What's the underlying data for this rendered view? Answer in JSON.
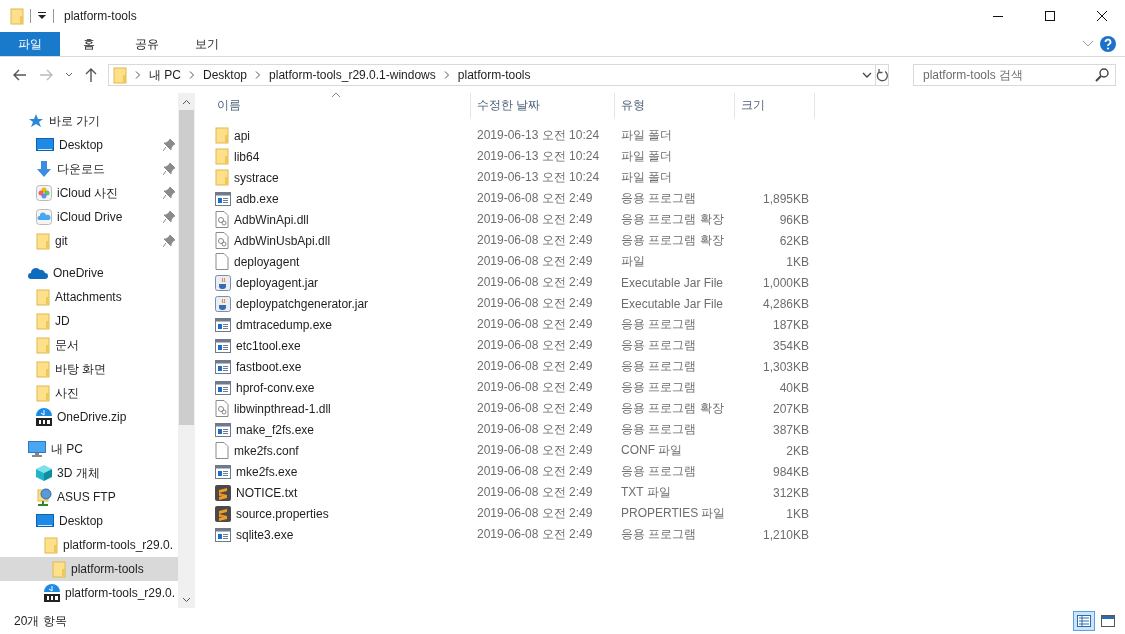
{
  "window": {
    "title": "platform-tools"
  },
  "ribbon_tabs": [
    {
      "label": "파일",
      "selected": true
    },
    {
      "label": "홈",
      "selected": false
    },
    {
      "label": "공유",
      "selected": false
    },
    {
      "label": "보기",
      "selected": false
    }
  ],
  "address": {
    "crumbs": [
      "내 PC",
      "Desktop",
      "platform-tools_r29.0.1-windows",
      "platform-tools"
    ]
  },
  "search": {
    "placeholder": "platform-tools 검색"
  },
  "sidebar": {
    "groups": [
      {
        "label": "바로 가기",
        "kind": "star",
        "selected": false,
        "children": [
          {
            "label": "Desktop",
            "kind": "desktop",
            "pinned": true,
            "selected": false
          },
          {
            "label": "다운로드",
            "kind": "download",
            "pinned": true,
            "selected": false
          },
          {
            "label": "iCloud 사진",
            "kind": "photos",
            "pinned": true,
            "selected": false
          },
          {
            "label": "iCloud Drive",
            "kind": "icloud",
            "pinned": true,
            "selected": false
          },
          {
            "label": "git",
            "kind": "folder",
            "pinned": true,
            "selected": false
          }
        ]
      },
      {
        "label": "OneDrive",
        "kind": "cloud",
        "selected": false,
        "children": [
          {
            "label": "Attachments",
            "kind": "folder",
            "selected": false
          },
          {
            "label": "JD",
            "kind": "folder",
            "selected": false
          },
          {
            "label": "문서",
            "kind": "folder",
            "selected": false
          },
          {
            "label": "바탕 화면",
            "kind": "folder",
            "selected": false
          },
          {
            "label": "사진",
            "kind": "folder",
            "selected": false
          },
          {
            "label": "OneDrive.zip",
            "kind": "zip",
            "selected": false
          }
        ]
      },
      {
        "label": "내 PC",
        "kind": "pc",
        "selected": false,
        "children": [
          {
            "label": "3D 개체",
            "kind": "cube",
            "selected": false
          },
          {
            "label": "ASUS FTP",
            "kind": "ftp",
            "selected": false
          },
          {
            "label": "Desktop",
            "kind": "desktop",
            "selected": false,
            "children": [
              {
                "label": "platform-tools_r29.0.",
                "kind": "folder",
                "selected": false,
                "children": [
                  {
                    "label": "platform-tools",
                    "kind": "folder",
                    "selected": true
                  }
                ]
              },
              {
                "label": "platform-tools_r29.0.",
                "kind": "zip",
                "selected": false
              }
            ]
          }
        ]
      }
    ]
  },
  "table": {
    "columns": [
      {
        "label": "이름",
        "sorted": true
      },
      {
        "label": "수정한 날짜",
        "sorted": false
      },
      {
        "label": "유형",
        "sorted": false
      },
      {
        "label": "크기",
        "sorted": false
      }
    ],
    "rows": [
      {
        "name": "api",
        "kind": "folder",
        "date": "2019-06-13 오전 10:24",
        "type": "파일 폴더",
        "size": ""
      },
      {
        "name": "lib64",
        "kind": "folder",
        "date": "2019-06-13 오전 10:24",
        "type": "파일 폴더",
        "size": ""
      },
      {
        "name": "systrace",
        "kind": "folder",
        "date": "2019-06-13 오전 10:24",
        "type": "파일 폴더",
        "size": ""
      },
      {
        "name": "adb.exe",
        "kind": "exe",
        "date": "2019-06-08 오전 2:49",
        "type": "응용 프로그램",
        "size": "1,895KB"
      },
      {
        "name": "AdbWinApi.dll",
        "kind": "dll",
        "date": "2019-06-08 오전 2:49",
        "type": "응용 프로그램 확장",
        "size": "96KB"
      },
      {
        "name": "AdbWinUsbApi.dll",
        "kind": "dll",
        "date": "2019-06-08 오전 2:49",
        "type": "응용 프로그램 확장",
        "size": "62KB"
      },
      {
        "name": "deployagent",
        "kind": "file",
        "date": "2019-06-08 오전 2:49",
        "type": "파일",
        "size": "1KB"
      },
      {
        "name": "deployagent.jar",
        "kind": "jar",
        "date": "2019-06-08 오전 2:49",
        "type": "Executable Jar File",
        "size": "1,000KB"
      },
      {
        "name": "deploypatchgenerator.jar",
        "kind": "jar",
        "date": "2019-06-08 오전 2:49",
        "type": "Executable Jar File",
        "size": "4,286KB"
      },
      {
        "name": "dmtracedump.exe",
        "kind": "exe",
        "date": "2019-06-08 오전 2:49",
        "type": "응용 프로그램",
        "size": "187KB"
      },
      {
        "name": "etc1tool.exe",
        "kind": "exe",
        "date": "2019-06-08 오전 2:49",
        "type": "응용 프로그램",
        "size": "354KB"
      },
      {
        "name": "fastboot.exe",
        "kind": "exe",
        "date": "2019-06-08 오전 2:49",
        "type": "응용 프로그램",
        "size": "1,303KB"
      },
      {
        "name": "hprof-conv.exe",
        "kind": "exe",
        "date": "2019-06-08 오전 2:49",
        "type": "응용 프로그램",
        "size": "40KB"
      },
      {
        "name": "libwinpthread-1.dll",
        "kind": "dll",
        "date": "2019-06-08 오전 2:49",
        "type": "응용 프로그램 확장",
        "size": "207KB"
      },
      {
        "name": "make_f2fs.exe",
        "kind": "exe",
        "date": "2019-06-08 오전 2:49",
        "type": "응용 프로그램",
        "size": "387KB"
      },
      {
        "name": "mke2fs.conf",
        "kind": "file",
        "date": "2019-06-08 오전 2:49",
        "type": "CONF 파일",
        "size": "2KB"
      },
      {
        "name": "mke2fs.exe",
        "kind": "exe",
        "date": "2019-06-08 오전 2:49",
        "type": "응용 프로그램",
        "size": "984KB"
      },
      {
        "name": "NOTICE.txt",
        "kind": "sublime",
        "date": "2019-06-08 오전 2:49",
        "type": "TXT 파일",
        "size": "312KB"
      },
      {
        "name": "source.properties",
        "kind": "sublime",
        "date": "2019-06-08 오전 2:49",
        "type": "PROPERTIES 파일",
        "size": "1KB"
      },
      {
        "name": "sqlite3.exe",
        "kind": "exe",
        "date": "2019-06-08 오전 2:49",
        "type": "응용 프로그램",
        "size": "1,210KB"
      }
    ]
  },
  "status_bar": {
    "item_count": "20개 항목",
    "views": [
      {
        "kind": "details",
        "selected": true
      },
      {
        "kind": "preview",
        "selected": false
      }
    ]
  }
}
